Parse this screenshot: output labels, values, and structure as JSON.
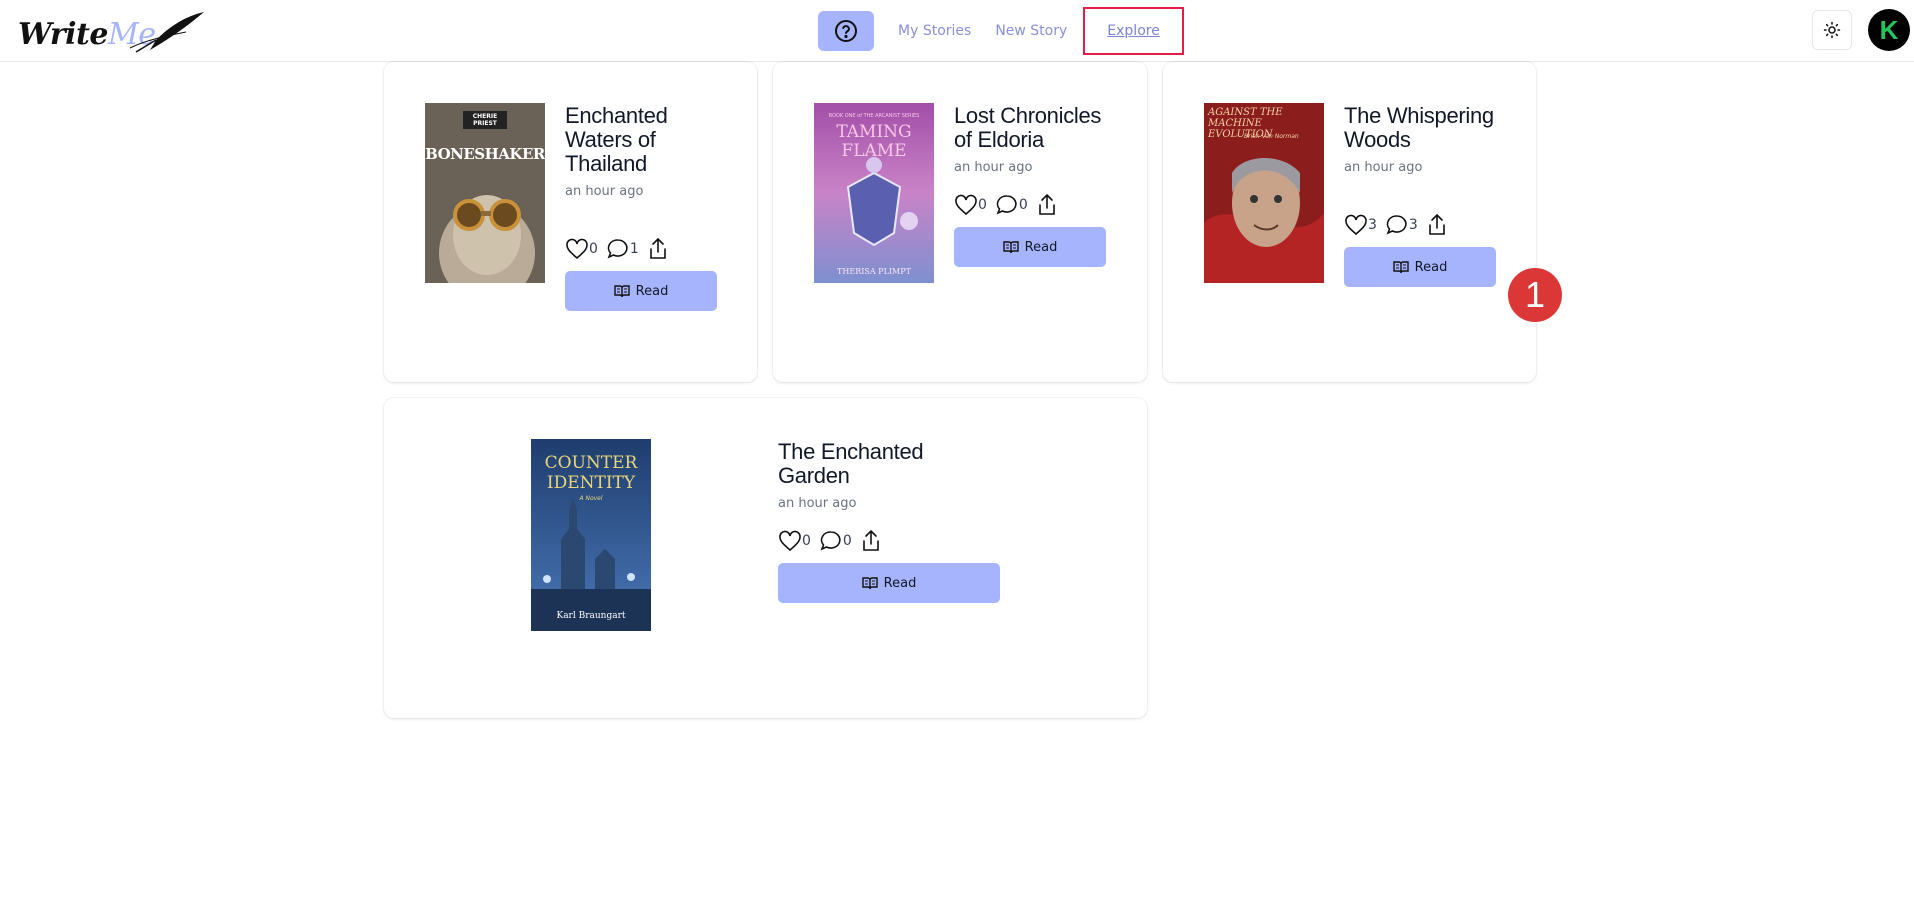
{
  "header": {
    "logo_part1": "Write",
    "logo_part2": "Me",
    "help_icon": "question-circle-icon",
    "nav": {
      "my_stories": "My Stories",
      "new_story": "New Story",
      "explore": "Explore"
    },
    "theme_icon": "sun-icon",
    "avatar_letter": "K"
  },
  "stories": [
    {
      "title": "Enchanted Waters of Thailand",
      "time": "an hour ago",
      "likes": "0",
      "comments": "1",
      "read_label": "Read",
      "cover": {
        "top_text": "CHERIE PRIEST",
        "main_text": "BONESHAKER",
        "bg": "#6b6257",
        "text_color": "#ffffff"
      }
    },
    {
      "title": "Lost Chronicles of Eldoria",
      "time": "an hour ago",
      "likes": "0",
      "comments": "0",
      "read_label": "Read",
      "cover": {
        "top_text": "BOOK ONE of THE ARCANIST SERIES",
        "main_text": "TAMING FLAME",
        "bottom_text": "THERISA PLIMPT",
        "bg": "#b06ab8",
        "text_color": "#f9c6e8"
      }
    },
    {
      "title": "The Whispering Woods",
      "time": "an hour ago",
      "likes": "3",
      "comments": "3",
      "read_label": "Read",
      "cover": {
        "top_text": "AGAINST THE MACHINE EVOLUTION",
        "author": "Brian Van Norman",
        "bg": "#8c1d1d",
        "text_color": "#f1d2a6"
      }
    },
    {
      "title": "The Enchanted Garden",
      "time": "an hour ago",
      "likes": "0",
      "comments": "0",
      "read_label": "Read",
      "cover": {
        "top_text": "COUNTER IDENTITY",
        "sub_text": "A Novel",
        "bottom_text": "Karl Braungart",
        "bg": "#2b4a7a",
        "text_color": "#e8d77a"
      }
    }
  ],
  "annotation_badge": "1",
  "colors": {
    "accent": "#a5b4fc",
    "nav_text": "#8b8fd6",
    "highlight_border": "#e11d48",
    "badge": "#dc3737"
  }
}
